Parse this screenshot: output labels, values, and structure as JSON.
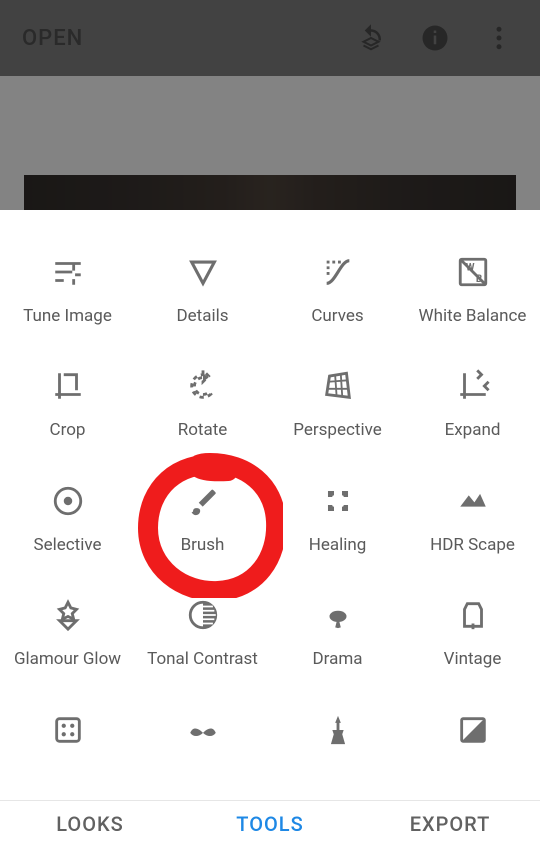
{
  "appbar": {
    "open_label": "OPEN",
    "icons": {
      "undo_stack": "undo-stack-icon",
      "info": "info-icon",
      "overflow": "more-vert-icon"
    }
  },
  "tools": [
    {
      "id": "tune-image",
      "label": "Tune Image",
      "icon": "tune-icon"
    },
    {
      "id": "details",
      "label": "Details",
      "icon": "triangle-down-icon"
    },
    {
      "id": "curves",
      "label": "Curves",
      "icon": "curves-icon"
    },
    {
      "id": "white-balance",
      "label": "White Balance",
      "icon": "white-balance-icon"
    },
    {
      "id": "crop",
      "label": "Crop",
      "icon": "crop-icon"
    },
    {
      "id": "rotate",
      "label": "Rotate",
      "icon": "rotate-icon"
    },
    {
      "id": "perspective",
      "label": "Perspective",
      "icon": "perspective-icon"
    },
    {
      "id": "expand",
      "label": "Expand",
      "icon": "expand-icon"
    },
    {
      "id": "selective",
      "label": "Selective",
      "icon": "selective-icon"
    },
    {
      "id": "brush",
      "label": "Brush",
      "icon": "brush-icon"
    },
    {
      "id": "healing",
      "label": "Healing",
      "icon": "healing-icon"
    },
    {
      "id": "hdr-scape",
      "label": "HDR Scape",
      "icon": "hdr-icon"
    },
    {
      "id": "glamour-glow",
      "label": "Glamour Glow",
      "icon": "glamour-icon"
    },
    {
      "id": "tonal-contrast",
      "label": "Tonal Contrast",
      "icon": "tonal-icon"
    },
    {
      "id": "drama",
      "label": "Drama",
      "icon": "drama-icon"
    },
    {
      "id": "vintage",
      "label": "Vintage",
      "icon": "vintage-icon"
    },
    {
      "id": "grainy-film",
      "label": "",
      "icon": "film-icon"
    },
    {
      "id": "retrolux",
      "label": "",
      "icon": "mustache-icon"
    },
    {
      "id": "grunge",
      "label": "",
      "icon": "guitar-icon"
    },
    {
      "id": "black-white",
      "label": "",
      "icon": "bw-icon"
    }
  ],
  "tabs": {
    "looks": "LOOKS",
    "tools": "TOOLS",
    "export": "EXPORT",
    "active": "tools"
  },
  "annotation": {
    "target_tool": "brush",
    "color": "#ef1c1c"
  }
}
